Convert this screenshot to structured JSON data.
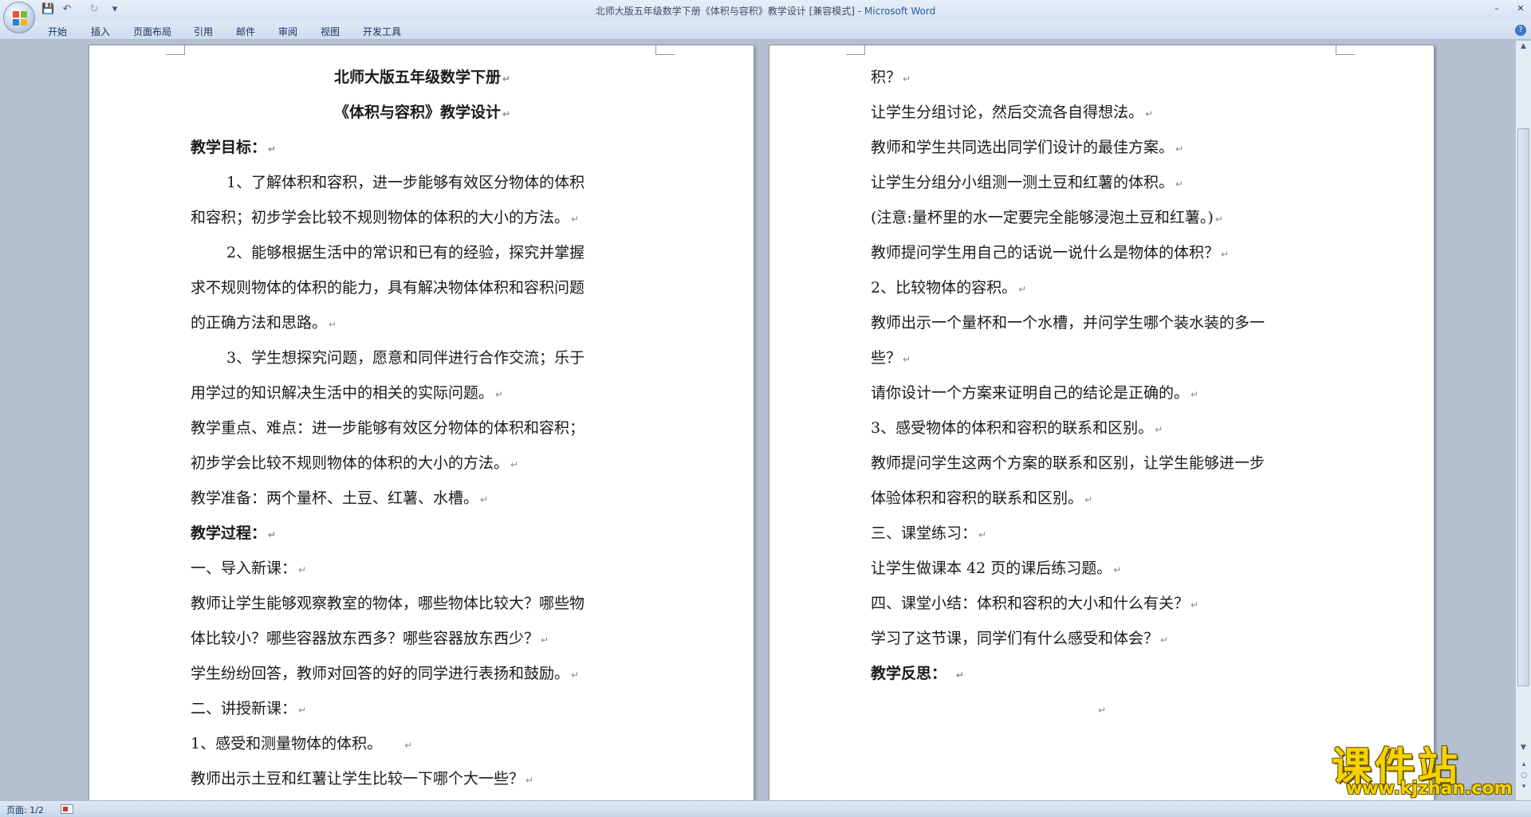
{
  "window": {
    "title_doc": "北师大版五年级数学下册《体积与容积》教学设计 [兼容模式] - ",
    "title_app": "Microsoft Word",
    "minimize": "–",
    "maximize": "□",
    "close": "✕"
  },
  "qat": {
    "save": "💾",
    "undo": "↶",
    "redo": "↻",
    "more": "▾"
  },
  "ribbon": {
    "tabs": [
      "开始",
      "插入",
      "页面布局",
      "引用",
      "邮件",
      "审阅",
      "视图",
      "开发工具"
    ],
    "help": "?"
  },
  "page_left": {
    "lines": [
      "北师大版五年级数学下册",
      "《体积与容积》教学设计",
      "教学目标：",
      "1、了解体积和容积，进一步能够有效区分物体的体积",
      "和容积；初步学会比较不规则物体的体积的大小的方法。",
      "2、能够根据生活中的常识和已有的经验，探究并掌握",
      "求不规则物体的体积的能力，具有解决物体体积和容积问题",
      "的正确方法和思路。",
      "3、学生想探究问题，愿意和同伴进行合作交流；乐于",
      "用学过的知识解决生活中的相关的实际问题。",
      "教学重点、难点：进一步能够有效区分物体的体积和容积；",
      "初步学会比较不规则物体的体积的大小的方法。",
      "教学准备：两个量杯、土豆、红薯、水槽。",
      "教学过程：",
      "一、导入新课：",
      "教师让学生能够观察教室的物体，哪些物体比较大？哪些物",
      "体比较小？哪些容器放东西多？哪些容器放东西少？",
      "学生纷纷回答，教师对回答的好的同学进行表扬和鼓励。",
      "二、讲授新课：",
      "1、感受和测量物体的体积。",
      "教师出示土豆和红薯让学生比较一下哪个大一些？"
    ]
  },
  "page_right": {
    "lines": [
      "积？",
      "让学生分组讨论，然后交流各自得想法。",
      "教师和学生共同选出同学们设计的最佳方案。",
      "让学生分组分小组测一测土豆和红薯的体积。",
      "(注意:量杯里的水一定要完全能够浸泡土豆和红薯。)",
      "教师提问学生用自己的话说一说什么是物体的体积？",
      "2、比较物体的容积。",
      "教师出示一个量杯和一个水槽，并问学生哪个装水装的多一",
      "些？",
      "请你设计一个方案来证明自己的结论是正确的。",
      "3、感受物体的体积和容积的联系和区别。",
      "教师提问学生这两个方案的联系和区别，让学生能够进一步",
      "体验体积和容积的联系和区别。",
      "三、课堂练习：",
      "让学生做课本 42 页的课后练习题。",
      "四、课堂小结：体积和容积的大小和什么有关？",
      "学习了这节课，同学们有什么感受和体会？",
      "教学反思：",
      ""
    ]
  },
  "paragraph_mark": "↵",
  "statusbar": {
    "page": "页面: 1/2"
  },
  "watermark": {
    "title": "课件站",
    "url": "www.kjzhan.com"
  },
  "scrollbar": {
    "up": "▲",
    "down": "▼",
    "prev": "▴",
    "select": "○",
    "next": "▾"
  }
}
